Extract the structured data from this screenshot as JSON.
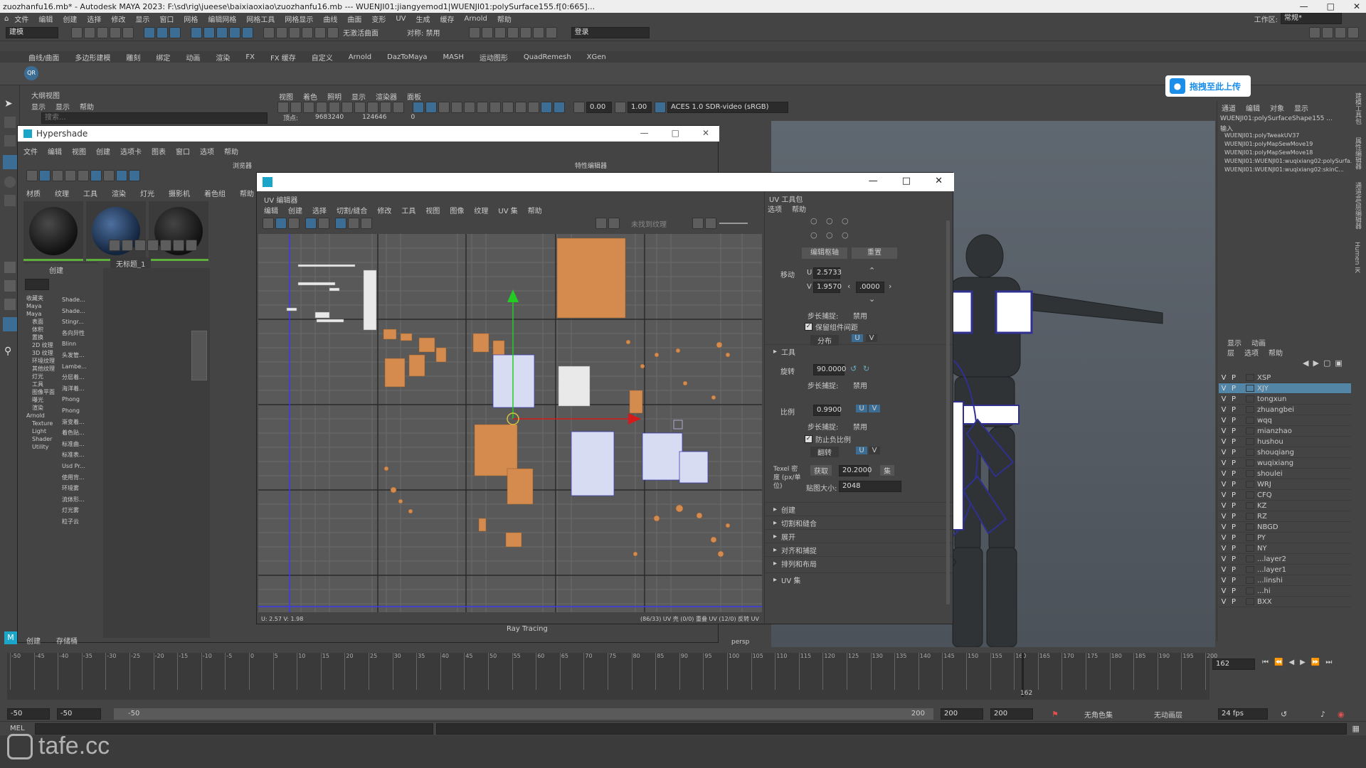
{
  "title_bar": {
    "text": "zuozhanfu16.mb* - Autodesk MAYA 2023: F:\\sd\\rig\\jueese\\baixiaoxiao\\zuozhanfu16.mb   ---   WUENJI01:jiangyemod1|WUENJI01:polySurface155.f[0:665]..."
  },
  "main_menu": [
    "文件",
    "编辑",
    "创建",
    "选择",
    "修改",
    "显示",
    "窗口",
    "网格",
    "编辑网格",
    "网格工具",
    "网格显示",
    "曲线",
    "曲面",
    "变形",
    "UV",
    "生成",
    "缓存",
    "Arnold",
    "帮助"
  ],
  "workspace": {
    "label": "工作区:",
    "value": "常规*"
  },
  "status_line": {
    "mode": "建模",
    "no_live": "无激活曲面",
    "symmetry": "对称: 禁用",
    "login": "登录"
  },
  "shelf_tabs": [
    "曲线/曲面",
    "多边形建模",
    "雕刻",
    "绑定",
    "动画",
    "渲染",
    "FX",
    "FX 缓存",
    "自定义",
    "Arnold",
    "DazToMaya",
    "MASH",
    "运动图形",
    "QuadRemesh",
    "XGen"
  ],
  "upload_badge": "拖拽至此上传",
  "outliner_header": {
    "title": "大纲视图",
    "menu": [
      "显示",
      "显示",
      "帮助"
    ],
    "search": "搜索..."
  },
  "viewport_menu": [
    "视图",
    "着色",
    "照明",
    "显示",
    "渲染器",
    "面板"
  ],
  "viewport_toolbar": {
    "val1": "0.00",
    "val2": "1.00",
    "colorspace": "ACES 1.0 SDR-video (sRGB)"
  },
  "poly_count": {
    "label": "顶点:",
    "v1": "9683240",
    "v2": "124646",
    "v3": "0"
  },
  "hypershade": {
    "title": "Hypershade",
    "menu": [
      "文件",
      "编辑",
      "视图",
      "创建",
      "选项卡",
      "图表",
      "窗口",
      "选项",
      "帮助"
    ],
    "browser_label": "浏览器",
    "props_label": "特性编辑器",
    "tabs": [
      "材质",
      "纹理",
      "工具",
      "渲染",
      "灯光",
      "摄影机",
      "着色组",
      "帮助"
    ],
    "create_label": "创建",
    "graph_tab": "无标题_1",
    "tree": [
      "收藏夹",
      "Maya",
      "Maya",
      "表面",
      "体积",
      "置换",
      "2D 纹理",
      "3D 纹理",
      "环境纹理",
      "其他纹理",
      "灯光",
      "工具",
      "图像平面",
      "曝光",
      "渲染",
      "Arnold",
      "Texture",
      "Light",
      "Shader",
      "Utility"
    ],
    "nodes": [
      "Shade...",
      "Shade...",
      "Stingr...",
      "各向异性",
      "Blinn",
      "头发管...",
      "Lambe...",
      "分层着...",
      "海洋着...",
      "Phong",
      "Phong",
      "渐变着...",
      "着色贴...",
      "标准曲...",
      "标准表...",
      "Usd Pr...",
      "使用背...",
      "环境雾",
      "流体形...",
      "灯光雾",
      "粒子云"
    ],
    "bottom_tabs": [
      "创建",
      "存储桶"
    ],
    "ray_tracing": "Ray Tracing"
  },
  "uv_editor": {
    "title": "UV 编辑器",
    "menu": [
      "编辑",
      "创建",
      "选择",
      "切割/缝合",
      "修改",
      "工具",
      "视图",
      "图像",
      "纹理",
      "UV 集",
      "帮助"
    ],
    "texture_label": "未找到纹理",
    "status_left": "U: 2.57 V: 1.98",
    "status_right": "(86/33) UV 壳 (0/0) 重叠 UV (12/0) 反转 UV"
  },
  "uv_toolkit": {
    "title": "UV 工具包",
    "menu": [
      "选项",
      "帮助"
    ],
    "btn_edit_pivot": "编辑枢轴",
    "btn_reset": "重置",
    "move_label": "移动",
    "u_label": "U",
    "u_value": "2.5733",
    "v_label": "V",
    "v_value": "1.9570",
    "step_value": ".0000",
    "step_snap": "步长捕捉:",
    "disabled": "禁用",
    "keep_spacing": "保留组件间距",
    "distribute": "分布",
    "u": "U",
    "v": "V",
    "tools_header": "工具",
    "rotate_label": "旋转",
    "rotate_value": "90.0000",
    "scale_label": "比例",
    "scale_value": "0.9900",
    "prevent_neg": "防止负比例",
    "flip": "翻转",
    "texel_label": "Texel 密度 (px/单位)",
    "texel_get": "获取",
    "texel_value": "20.2000",
    "texel_set": "集",
    "map_size_label": "贴图大小:",
    "map_size": "2048",
    "sections": [
      "创建",
      "切割和缝合",
      "展开",
      "对齐和捕捉",
      "排列和布局",
      "UV 集"
    ]
  },
  "persp_label": "persp",
  "channel_box": {
    "tabs": [
      "通道",
      "编辑",
      "对象",
      "显示"
    ],
    "object": "WUENJI01:polySurfaceShape155 ...",
    "input_label": "输入",
    "inputs": [
      "WUENJI01:polyTweakUV37",
      "WUENJI01:polyMapSewMove19",
      "WUENJI01:polyMapSewMove18",
      "WUENJI01:WUENJI01:wuqixiang02:polySurfa...",
      "WUENJI01:WUENJI01:wuqixiang02:skinC..."
    ]
  },
  "layers": {
    "tabs": [
      "显示",
      "动画"
    ],
    "menu": [
      "层",
      "选项",
      "帮助"
    ],
    "items": [
      "XSP",
      "XJY",
      "tongxun",
      "zhuangbei",
      "wqq",
      "mianzhao",
      "hushou",
      "shouqiang",
      "wuqixiang",
      "shoulei",
      "WRJ",
      "CFQ",
      "KZ",
      "RZ",
      "NBGD",
      "PY",
      "NY",
      "...layer2",
      "...layer1",
      "...linshi",
      "...hi",
      "BXX"
    ],
    "selected_index": 1
  },
  "right_vertical_tabs": [
    "建模工具包",
    "属性编辑器",
    "通道盒/层编辑器",
    "Humen IK"
  ],
  "timeline": {
    "ticks": [
      "-50",
      "-45",
      "-40",
      "-35",
      "-30",
      "-25",
      "-20",
      "-15",
      "-10",
      "-5",
      "0",
      "5",
      "10",
      "15",
      "20",
      "25",
      "30",
      "35",
      "40",
      "45",
      "50",
      "55",
      "60",
      "65",
      "70",
      "75",
      "80",
      "85",
      "90",
      "95",
      "100",
      "105",
      "110",
      "115",
      "120",
      "125",
      "130",
      "135",
      "140",
      "145",
      "150",
      "155",
      "160",
      "165",
      "170",
      "175",
      "180",
      "185",
      "190",
      "195",
      "200"
    ],
    "current_frame": "162",
    "current_frame_field": "162"
  },
  "range": {
    "start": "-50",
    "start2": "-50",
    "range_start": "-50",
    "range_end": "200",
    "end": "200",
    "end2": "200",
    "char_set": "无角色集",
    "anim_layer": "无动画层",
    "fps": "24 fps"
  },
  "mel_label": "MEL",
  "watermark": "tafe.cc"
}
